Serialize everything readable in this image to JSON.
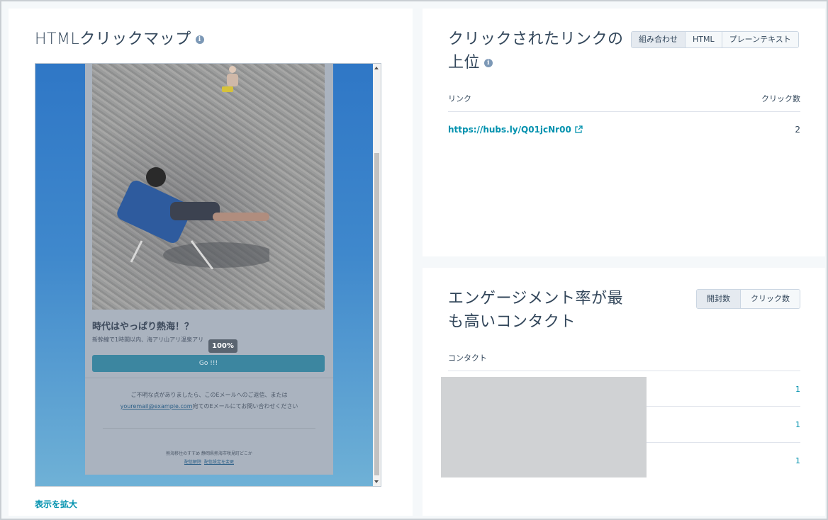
{
  "heatmap": {
    "title": "HTMLクリックマップ",
    "expand_label": "表示を拡大",
    "preview": {
      "heading": "時代はやっぱり熱海！？",
      "subtext": "新幹線で1時間以内、海アリ山アリ温泉アリ",
      "percent_badge": "100%",
      "button_label": "Go !!!",
      "contact_line1": "ご不明な点がありましたら、このEメールへのご返信、または",
      "contact_email": "youremail@example.com",
      "contact_line2_suffix": "宛てのEメールにてお問い合わせください",
      "footer_line1": "熱海移住のすすめ 静岡県熱海市咲見町どこか",
      "footer_unsubscribe": "配信解除",
      "footer_settings": "配信設定を変更"
    }
  },
  "top_links": {
    "title_line1": "クリックされたリンクの",
    "title_line2": "上位",
    "tabs": [
      "組み合わせ",
      "HTML",
      "プレーンテキスト"
    ],
    "active_tab": "組み合わせ",
    "col_link": "リンク",
    "col_clicks": "クリック数",
    "rows": [
      {
        "url": "https://hubs.ly/Q01jcNr00",
        "clicks": "2"
      }
    ]
  },
  "top_contacts": {
    "title_line1": "エンゲージメント率が最",
    "title_line2": "も高いコンタクト",
    "tabs": [
      "開封数",
      "クリック数"
    ],
    "active_tab": "開封数",
    "col_contact": "コンタクト",
    "rows": [
      {
        "count": "1"
      },
      {
        "count": "1"
      },
      {
        "count": "1"
      }
    ]
  },
  "colors": {
    "accent": "#0091ae",
    "text": "#33475b",
    "border": "#cbd6e2"
  }
}
